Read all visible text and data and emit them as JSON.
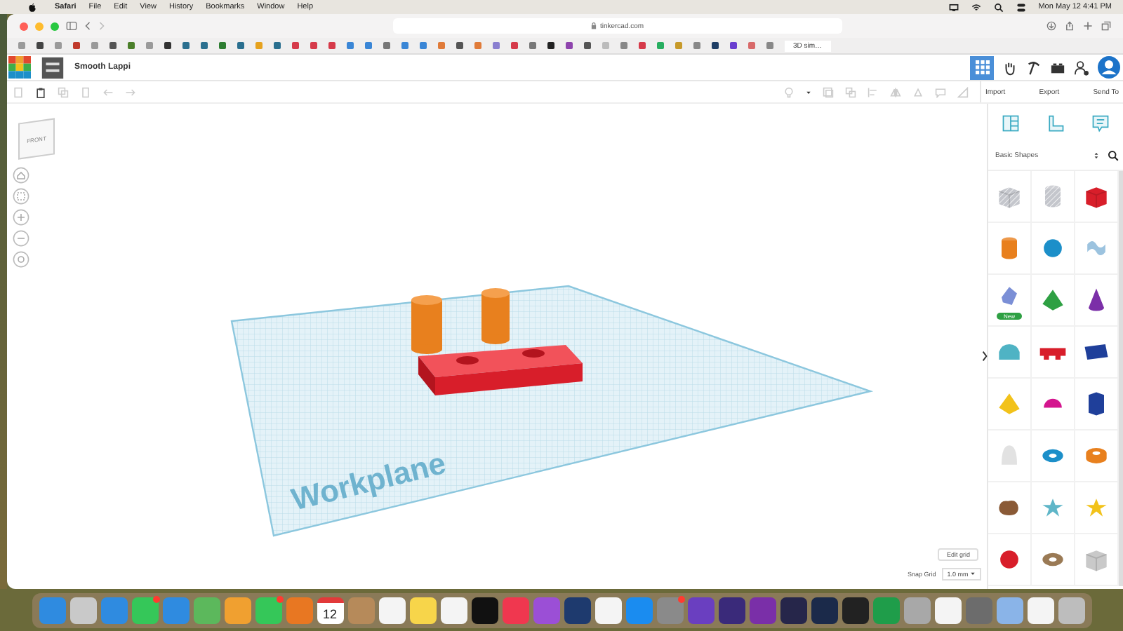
{
  "menubar": {
    "items": [
      {
        "label": "Safari",
        "bold": true
      },
      {
        "label": "File",
        "bold": false
      },
      {
        "label": "Edit",
        "bold": false
      },
      {
        "label": "View",
        "bold": false
      },
      {
        "label": "History",
        "bold": false
      },
      {
        "label": "Bookmarks",
        "bold": false
      },
      {
        "label": "Window",
        "bold": false
      },
      {
        "label": "Help",
        "bold": false
      }
    ],
    "clock": "Mon May 12  4:41 PM"
  },
  "browser": {
    "url": "tinkercad.com",
    "favicons": [
      {
        "color": "#9a9a9a"
      },
      {
        "color": "#444444"
      },
      {
        "color": "#9a9a9a"
      },
      {
        "color": "#c0392b"
      },
      {
        "color": "#9a9a9a"
      },
      {
        "color": "#555555"
      },
      {
        "color": "#4b7f2a"
      },
      {
        "color": "#9a9a9a"
      },
      {
        "color": "#333333"
      },
      {
        "color": "#2a6f8f"
      },
      {
        "color": "#2a6f8f"
      },
      {
        "color": "#2e7d32"
      },
      {
        "color": "#2a6f8f"
      },
      {
        "color": "#e6a21e"
      },
      {
        "color": "#2a6f8f"
      },
      {
        "color": "#d63a4a"
      },
      {
        "color": "#d63a4a"
      },
      {
        "color": "#d63a4a"
      },
      {
        "color": "#3a86d6"
      },
      {
        "color": "#3a86d6"
      },
      {
        "color": "#777777"
      },
      {
        "color": "#3a86d6"
      },
      {
        "color": "#3a86d6"
      },
      {
        "color": "#e07b39"
      },
      {
        "color": "#555555"
      },
      {
        "color": "#e07b39"
      },
      {
        "color": "#8a7fd0"
      },
      {
        "color": "#d63a4a"
      },
      {
        "color": "#777777"
      },
      {
        "color": "#222222"
      },
      {
        "color": "#8e44ad"
      },
      {
        "color": "#555555"
      },
      {
        "color": "#bbbbbb"
      },
      {
        "color": "#888888"
      },
      {
        "color": "#d63a4a"
      },
      {
        "color": "#27ae60"
      },
      {
        "color": "#c79a2a"
      },
      {
        "color": "#888888"
      },
      {
        "color": "#1f3f66"
      },
      {
        "color": "#6a3fd0"
      },
      {
        "color": "#d86a6a"
      },
      {
        "color": "#888888"
      }
    ],
    "tab": "3D sim…"
  },
  "app": {
    "title": "Smooth Lappi",
    "panel_tabs": [
      "Import",
      "Export",
      "Send To"
    ],
    "category": "Basic Shapes",
    "shapes": [
      {
        "kind": "box",
        "color": "#c4c6cc",
        "hole": true
      },
      {
        "kind": "cylinder",
        "color": "#c4c6cc",
        "hole": true
      },
      {
        "kind": "box",
        "color": "#d81e2a",
        "hole": false
      },
      {
        "kind": "cylinder",
        "color": "#e8801e",
        "hole": false
      },
      {
        "kind": "sphere",
        "color": "#1c8fc9",
        "hole": false
      },
      {
        "kind": "squiggle",
        "color": "#9cc3df",
        "hole": false
      },
      {
        "kind": "gem",
        "color": "#7b8fd6",
        "hole": false,
        "badge": "New"
      },
      {
        "kind": "pyramid",
        "color": "#2ea043",
        "hole": false
      },
      {
        "kind": "cone",
        "color": "#7b2fa8",
        "hole": false
      },
      {
        "kind": "roof",
        "color": "#4fb3c4",
        "hole": false
      },
      {
        "kind": "text",
        "color": "#d81e2a",
        "hole": false
      },
      {
        "kind": "wedge",
        "color": "#1f3f9a",
        "hole": false
      },
      {
        "kind": "pyramid",
        "color": "#f2c21a",
        "hole": false
      },
      {
        "kind": "halfsphere",
        "color": "#d4158e",
        "hole": false
      },
      {
        "kind": "hexprism",
        "color": "#1f3f9a",
        "hole": false
      },
      {
        "kind": "paraboloid",
        "color": "#e2e2e2",
        "hole": false
      },
      {
        "kind": "torus",
        "color": "#1c8fc9",
        "hole": false
      },
      {
        "kind": "tube",
        "color": "#e8801e",
        "hole": false
      },
      {
        "kind": "blob",
        "color": "#8a5a36",
        "hole": false
      },
      {
        "kind": "star",
        "color": "#5fb6c8",
        "hole": false
      },
      {
        "kind": "star",
        "color": "#f2c21a",
        "hole": false
      },
      {
        "kind": "sphere",
        "color": "#d81e2a",
        "hole": false
      },
      {
        "kind": "torus",
        "color": "#9a7a55",
        "hole": false
      },
      {
        "kind": "box",
        "color": "#c9c9c9",
        "hole": false
      }
    ],
    "viewcube": "FRONT",
    "workplane": "Workplane",
    "edit_grid": "Edit grid",
    "snap_label": "Snap Grid",
    "snap_value": "1.0 mm"
  },
  "dock": [
    {
      "kind": "app",
      "color": "#2f8be0",
      "badge": false
    },
    {
      "kind": "app",
      "color": "#c9c9c9",
      "badge": false
    },
    {
      "kind": "app",
      "color": "#2f8be0",
      "badge": false
    },
    {
      "kind": "app",
      "color": "#35c759",
      "badge": true
    },
    {
      "kind": "app",
      "color": "#2f8be0",
      "badge": false
    },
    {
      "kind": "app",
      "color": "#5cb85c",
      "badge": false
    },
    {
      "kind": "app",
      "color": "#f0a030",
      "badge": false
    },
    {
      "kind": "app",
      "color": "#35c759",
      "badge": true
    },
    {
      "kind": "app",
      "color": "#e87722",
      "badge": false
    },
    {
      "kind": "calendar",
      "color": "#ffffff",
      "badge": false,
      "day": "12"
    },
    {
      "kind": "app",
      "color": "#b68a5a",
      "badge": false
    },
    {
      "kind": "app",
      "color": "#f4f4f4",
      "badge": false
    },
    {
      "kind": "app",
      "color": "#f7d54a",
      "badge": false
    },
    {
      "kind": "app",
      "color": "#f4f4f4",
      "badge": false
    },
    {
      "kind": "app",
      "color": "#111111",
      "badge": false
    },
    {
      "kind": "app",
      "color": "#f0374f",
      "badge": false
    },
    {
      "kind": "app",
      "color": "#9b4fd6",
      "badge": false
    },
    {
      "kind": "app",
      "color": "#1e3a6e",
      "badge": false
    },
    {
      "kind": "app",
      "color": "#f4f4f4",
      "badge": false
    },
    {
      "kind": "app",
      "color": "#1a8cf0",
      "badge": false
    },
    {
      "kind": "app",
      "color": "#8a8a8a",
      "badge": true
    },
    {
      "kind": "app",
      "color": "#6a3fc0",
      "badge": false
    },
    {
      "kind": "app",
      "color": "#3a2a7a",
      "badge": false
    },
    {
      "kind": "app",
      "color": "#7a2fa8",
      "badge": false
    },
    {
      "kind": "app",
      "color": "#26264a",
      "badge": false
    },
    {
      "kind": "app",
      "color": "#1b2a4a",
      "badge": false
    },
    {
      "kind": "app",
      "color": "#222222",
      "badge": false
    },
    {
      "kind": "app",
      "color": "#1f9d4a",
      "badge": false
    },
    {
      "kind": "app",
      "color": "#a8a8a8",
      "badge": false
    },
    {
      "kind": "app",
      "color": "#f4f4f4",
      "badge": false
    },
    {
      "kind": "app",
      "color": "#6c6c6c",
      "badge": false
    },
    {
      "kind": "app",
      "color": "#8ab4e8",
      "badge": false
    },
    {
      "kind": "app",
      "color": "#f4f4f4",
      "badge": false
    },
    {
      "kind": "app",
      "color": "#bdbdbd",
      "badge": false
    }
  ]
}
